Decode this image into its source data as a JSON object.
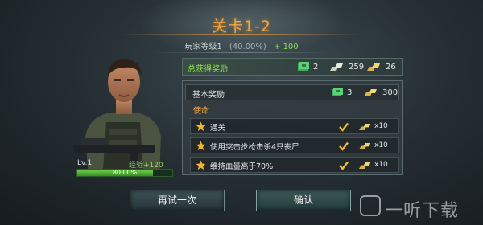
{
  "stage": {
    "title": "关卡1-2"
  },
  "player": {
    "level_label": "玩家等级1",
    "percent": "(40.00%)",
    "gain": "+ 100",
    "exp_progress": 0.8
  },
  "character": {
    "level": "Lv.1",
    "exp_label": "经验+120",
    "exp_percent": "80.00%"
  },
  "total_reward": {
    "label": "总获得奖励",
    "items": [
      {
        "icon": "cash-stack-icon",
        "value": "2"
      },
      {
        "icon": "silver-bars-icon",
        "value": "259"
      },
      {
        "icon": "gold-bars-icon",
        "value": "26"
      }
    ]
  },
  "base_reward": {
    "label": "基本奖励",
    "items": [
      {
        "icon": "cash-stack-icon",
        "value": "3"
      },
      {
        "icon": "gold-bars-icon",
        "value": "300"
      }
    ]
  },
  "missions": {
    "label": "使命",
    "items": [
      {
        "text": "通关",
        "completed": true,
        "reward": "x10"
      },
      {
        "text": "使用突击步枪击杀4只丧尸",
        "completed": true,
        "reward": "x10"
      },
      {
        "text": "维持血量高于70%",
        "completed": true,
        "reward": "x10"
      }
    ]
  },
  "buttons": {
    "retry": "再试一次",
    "confirm": "确认"
  },
  "watermark": {
    "text": "一听下载"
  },
  "colors": {
    "title": "#f0a53a",
    "green_text": "#8ee04f",
    "exp_bar": "#6ed44a"
  }
}
